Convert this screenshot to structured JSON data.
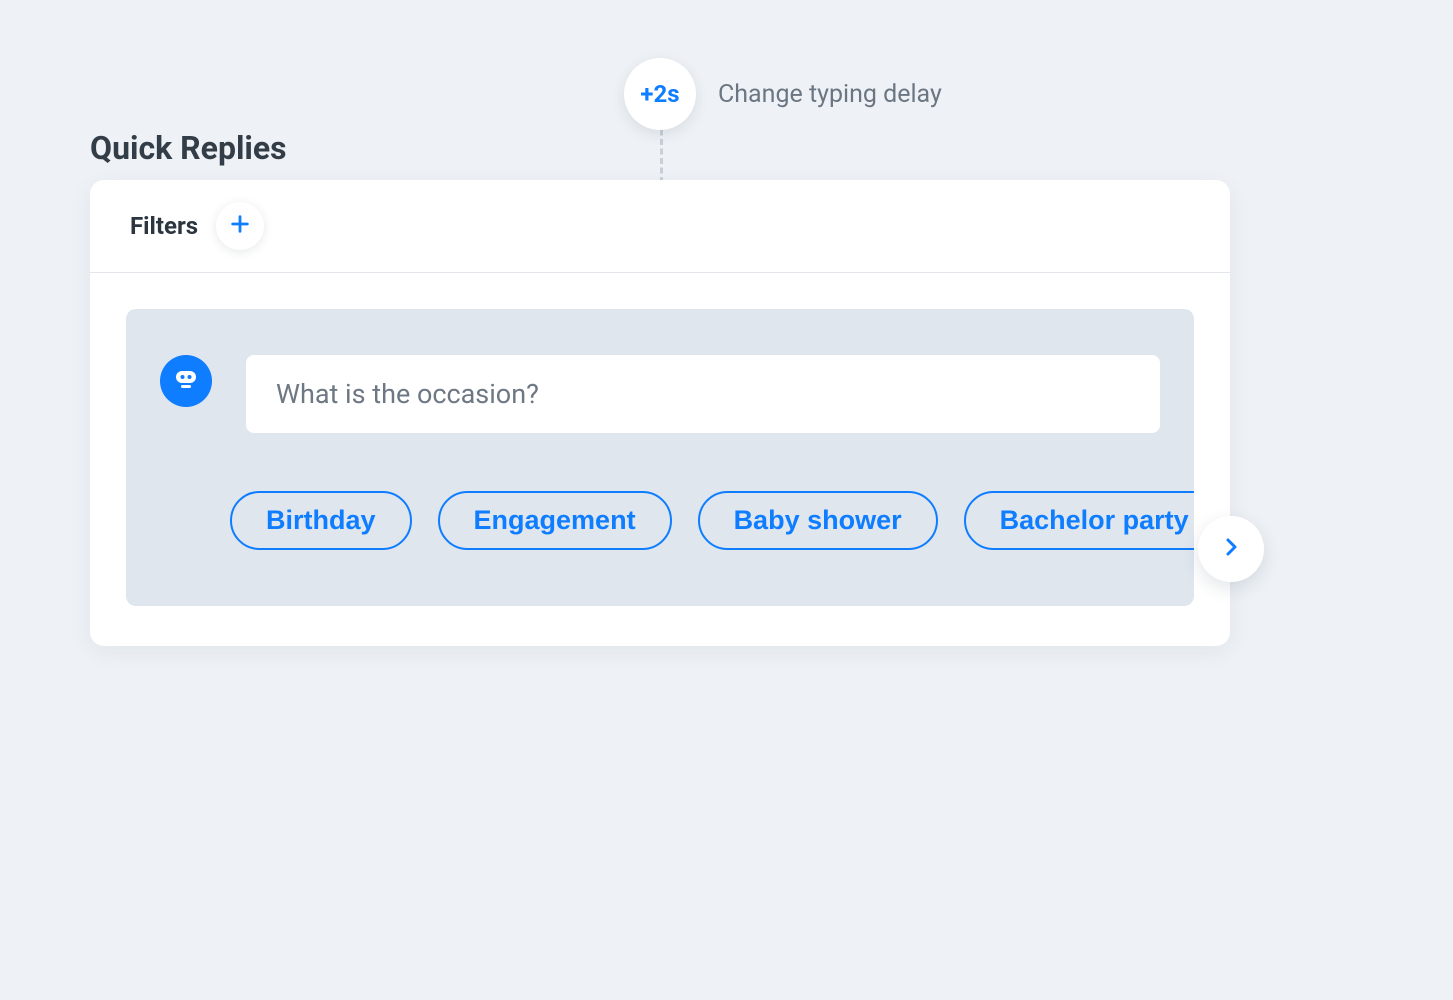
{
  "title": "Quick Replies",
  "typing_delay": {
    "badge": "+2s",
    "label": "Change typing delay"
  },
  "filters": {
    "label": "Filters"
  },
  "message": {
    "prompt": "What is the occasion?"
  },
  "quick_replies": [
    "Birthday",
    "Engagement",
    "Baby shower",
    "Bachelor party"
  ],
  "icons": {
    "plus": "plus-icon",
    "bot": "bot-icon",
    "chevron_right": "chevron-right-icon"
  },
  "colors": {
    "accent": "#0f7dff",
    "page_bg": "#eef2f6",
    "panel_bg": "#dfe6ee"
  }
}
